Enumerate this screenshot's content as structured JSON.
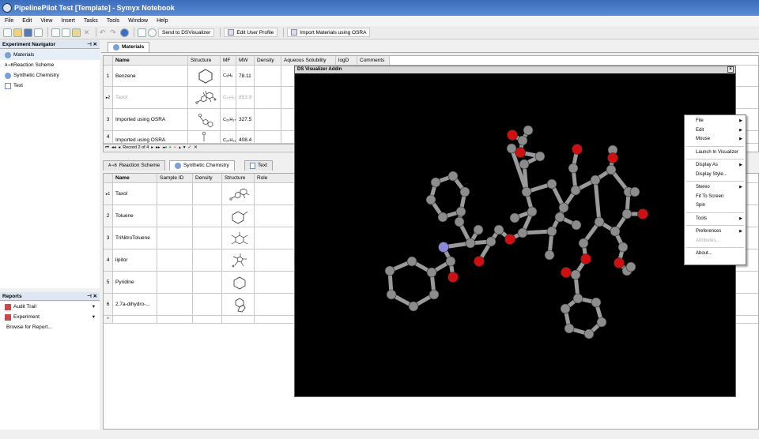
{
  "window": {
    "title": "PipelinePilot Test [Template] - Symyx Notebook"
  },
  "menu": [
    "File",
    "Edit",
    "View",
    "Insert",
    "Tasks",
    "Tools",
    "Window",
    "Help"
  ],
  "toolbar": {
    "send": "Send to DSVisualizer",
    "edit_profile": "Edit User Profile",
    "import": "Import Materials using OSRA"
  },
  "nav": {
    "title": "Experiment Navigator",
    "items": [
      {
        "label": "Materials",
        "icon": "flask-icon"
      },
      {
        "label": "Reaction Scheme",
        "icon": "reaction-icon"
      },
      {
        "label": "Synthetic Chemistry",
        "icon": "flask-icon"
      },
      {
        "label": "Text",
        "icon": "document-icon"
      }
    ]
  },
  "reports": {
    "title": "Reports",
    "items": [
      {
        "label": "Audit Trail"
      },
      {
        "label": "Experiment"
      },
      {
        "label": "Browse for Report..."
      }
    ]
  },
  "materials": {
    "tab": "Materials",
    "columns": [
      "Name",
      "Structure",
      "MF",
      "MW",
      "Density",
      "Aqueous Solubility",
      "logD",
      "Comments"
    ],
    "rows": [
      {
        "n": "1",
        "name": "Benzene",
        "mf": "C₆H₆",
        "mw": "78.11"
      },
      {
        "n": "2",
        "name": "Taxol",
        "mf": "C₄₇H₅₁",
        "mw": "853.9"
      },
      {
        "n": "3",
        "name": "Imported using OSRA",
        "mf": "C₂₀H₁₇",
        "mw": "327.5"
      },
      {
        "n": "4",
        "name": "Imported using OSRA",
        "mf": "C₂₀H₂₂",
        "mw": "408.4"
      }
    ],
    "record": "Record 2 of 4"
  },
  "bottom_tabs": [
    "Reaction Scheme",
    "Synthetic Chemistry",
    "Text"
  ],
  "synth": {
    "columns": [
      "Name",
      "Sample ID",
      "Density",
      "Structure",
      "Role"
    ],
    "rows": [
      {
        "n": "1",
        "name": "Taxol"
      },
      {
        "n": "2",
        "name": "Toluene"
      },
      {
        "n": "3",
        "name": "TriNitroToluene"
      },
      {
        "n": "4",
        "name": "lipitor"
      },
      {
        "n": "5",
        "name": "Pyridine"
      },
      {
        "n": "6",
        "name": "2,7a-dihydro-..."
      }
    ]
  },
  "visualizer": {
    "title": "DS Visualizer Addin",
    "close": "×"
  },
  "context_menu": [
    {
      "label": "File",
      "sub": true
    },
    {
      "label": "Edit",
      "sub": true
    },
    {
      "label": "Mouse",
      "sub": true
    },
    {
      "sep": true
    },
    {
      "label": "Launch In Visualizer"
    },
    {
      "sep": true
    },
    {
      "label": "Display As",
      "sub": true
    },
    {
      "label": "Display Style..."
    },
    {
      "sep": true
    },
    {
      "label": "Stereo",
      "sub": true
    },
    {
      "label": "Fit To Screen"
    },
    {
      "label": "Spin"
    },
    {
      "sep": true
    },
    {
      "label": "Tools",
      "sub": true
    },
    {
      "sep": true
    },
    {
      "label": "Preferences",
      "sub": true
    },
    {
      "label": "Attributes...",
      "disabled": true
    },
    {
      "sep": true
    },
    {
      "label": "About..."
    }
  ],
  "colors": {
    "carbon": "#8c8c8c",
    "oxygen": "#d01010",
    "nitrogen": "#8a8adc"
  }
}
